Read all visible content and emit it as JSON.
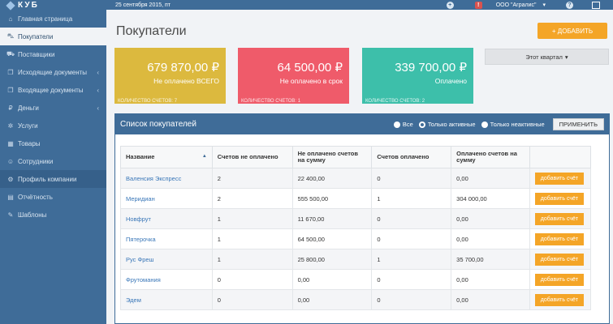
{
  "logo": {
    "text": "КУБ"
  },
  "topbar": {
    "date": "25 сентября 2015, пт",
    "company": "ООО \"Агралис\""
  },
  "sidebar": {
    "items": [
      {
        "label": "Главная страница",
        "icon": "home-icon",
        "glyph": "⌂"
      },
      {
        "label": "Покупатели",
        "icon": "cart-icon",
        "glyph": "⛟"
      },
      {
        "label": "Поставщики",
        "icon": "truck-icon",
        "glyph": "⛟"
      },
      {
        "label": "Исходящие документы",
        "icon": "documents-out-icon",
        "glyph": "❐"
      },
      {
        "label": "Входящие документы",
        "icon": "documents-in-icon",
        "glyph": "❐"
      },
      {
        "label": "Деньги",
        "icon": "ruble-icon",
        "glyph": "₽"
      },
      {
        "label": "Услуги",
        "icon": "tools-icon",
        "glyph": "✲"
      },
      {
        "label": "Товары",
        "icon": "box-icon",
        "glyph": "▦"
      },
      {
        "label": "Сотрудники",
        "icon": "users-icon",
        "glyph": "☺"
      },
      {
        "label": "Профиль компании",
        "icon": "gear-icon",
        "glyph": "⚙"
      },
      {
        "label": "Отчётность",
        "icon": "report-icon",
        "glyph": "▤"
      },
      {
        "label": "Шаблоны",
        "icon": "edit-icon",
        "glyph": "✎"
      }
    ]
  },
  "page": {
    "title": "Покупатели",
    "add_label": "+ ДОБАВИТЬ",
    "period_label": "Этот квартал"
  },
  "cards": [
    {
      "amount": "679 870,00 ₽",
      "label": "Не оплачено ВСЕГО",
      "foot": "КОЛИЧЕСТВО СЧЕТОВ: 7",
      "color": "#dcb93e"
    },
    {
      "amount": "64 500,00 ₽",
      "label": "Не оплачено в срок",
      "foot": "КОЛИЧЕСТВО СЧЕТОВ: 1",
      "color": "#ef5b6a"
    },
    {
      "amount": "339 700,00 ₽",
      "label": "Оплачено",
      "foot": "КОЛИЧЕСТВО СЧЕТОВ: 2",
      "color": "#3dbfaa"
    }
  ],
  "panel": {
    "title": "Список покупателей",
    "filter_all": "Все",
    "filter_active": "Только активные",
    "filter_inactive": "Только неактивные",
    "apply_label": "ПРИМЕНИТЬ"
  },
  "table": {
    "headers": [
      "Название",
      "Счетов не оплачено",
      "Не оплачено счетов на сумму",
      "Счетов оплачено",
      "Оплачено счетов на сумму"
    ],
    "button_label": "добавить счёт",
    "rows": [
      [
        "Валенсия Экспресс",
        "2",
        "22 400,00",
        "0",
        "0,00"
      ],
      [
        "Меридиан",
        "2",
        "555 500,00",
        "1",
        "304 000,00"
      ],
      [
        "Новфрут",
        "1",
        "11 670,00",
        "0",
        "0,00"
      ],
      [
        "Пятерочка",
        "1",
        "64 500,00",
        "0",
        "0,00"
      ],
      [
        "Рус Фреш",
        "1",
        "25 800,00",
        "1",
        "35 700,00"
      ],
      [
        "Фрутомания",
        "0",
        "0,00",
        "0",
        "0,00"
      ],
      [
        "Эдем",
        "0",
        "0,00",
        "0",
        "0,00"
      ]
    ]
  },
  "colors": {
    "primary": "#3f6c98",
    "accent": "#f4a527"
  }
}
